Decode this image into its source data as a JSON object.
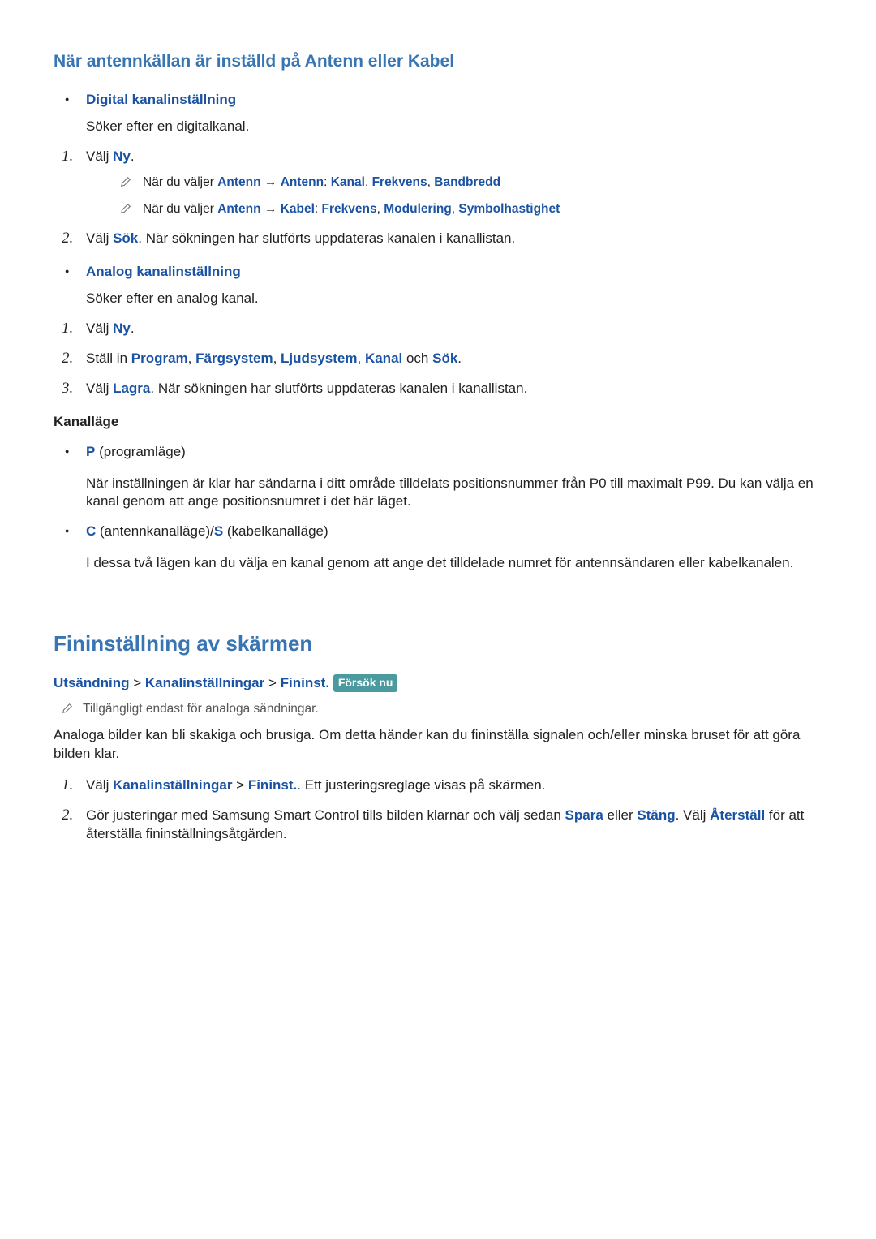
{
  "section1": {
    "title": "När antennkällan är inställd på Antenn eller Kabel",
    "digital": {
      "label": "Digital kanalinställning",
      "desc": "Söker efter en digitalkanal.",
      "step1_pre": "Välj ",
      "step1_bold": "Ny",
      "step1_post": ".",
      "note1_pre": "När du väljer ",
      "note1_b1": "Antenn",
      "note1_arrow": " → ",
      "note1_b2": "Antenn",
      "note1_colon": ": ",
      "note1_b3": "Kanal",
      "note1_c1": ", ",
      "note1_b4": "Frekvens",
      "note1_c2": ", ",
      "note1_b5": "Bandbredd",
      "note2_pre": "När du väljer ",
      "note2_b1": "Antenn",
      "note2_arrow": " → ",
      "note2_b2": "Kabel",
      "note2_colon": ": ",
      "note2_b3": "Frekvens",
      "note2_c1": ", ",
      "note2_b4": "Modulering",
      "note2_c2": ", ",
      "note2_b5": "Symbolhastighet",
      "step2_pre": "Välj ",
      "step2_bold": "Sök",
      "step2_post": ". När sökningen har slutförts uppdateras kanalen i kanallistan."
    },
    "analog": {
      "label": "Analog kanalinställning",
      "desc": "Söker efter en analog kanal.",
      "step1_pre": "Välj ",
      "step1_bold": "Ny",
      "step1_post": ".",
      "step2_pre": "Ställ in ",
      "step2_b1": "Program",
      "step2_c1": ", ",
      "step2_b2": "Färgsystem",
      "step2_c2": ", ",
      "step2_b3": "Ljudsystem",
      "step2_c3": ", ",
      "step2_b4": "Kanal",
      "step2_mid": " och ",
      "step2_b5": "Sök",
      "step2_post": ".",
      "step3_pre": "Välj ",
      "step3_bold": "Lagra",
      "step3_post": ". När sökningen har slutförts uppdateras kanalen i kanallistan."
    },
    "kanallage": {
      "title": "Kanalläge",
      "p_label": "P",
      "p_text": " (programläge)",
      "p_desc": "När inställningen är klar har sändarna i ditt område tilldelats positionsnummer från P0 till maximalt P99. Du kan välja en kanal genom att ange positionsnumret i det här läget.",
      "c_label": "C",
      "c_mid": " (antennkanalläge)/",
      "s_label": "S",
      "s_text": " (kabelkanalläge)",
      "cs_desc": "I dessa två lägen kan du välja en kanal genom att ange det tilldelade numret för antennsändaren eller kabelkanalen."
    }
  },
  "section2": {
    "title": "Fininställning av skärmen",
    "bc1": "Utsändning",
    "sep": " > ",
    "bc2": "Kanalinställningar",
    "bc3": "Fininst.",
    "try_now": "Försök nu",
    "note": "Tillgängligt endast för analoga sändningar.",
    "para": "Analoga bilder kan bli skakiga och brusiga. Om detta händer kan du fininställa signalen och/eller minska bruset för att göra bilden klar.",
    "step1_pre": "Välj ",
    "step1_b1": "Kanalinställningar",
    "step1_sep": " > ",
    "step1_b2": "Fininst.",
    "step1_post": ". Ett justeringsreglage visas på skärmen.",
    "step2_pre": "Gör justeringar med Samsung Smart Control tills bilden klarnar och välj sedan ",
    "step2_b1": "Spara",
    "step2_mid1": " eller ",
    "step2_b2": "Stäng",
    "step2_mid2": ". Välj ",
    "step2_b3": "Återställ",
    "step2_post": " för att återställa fininställningsåtgärden."
  },
  "numbers": {
    "n1": "1.",
    "n2": "2.",
    "n3": "3."
  }
}
